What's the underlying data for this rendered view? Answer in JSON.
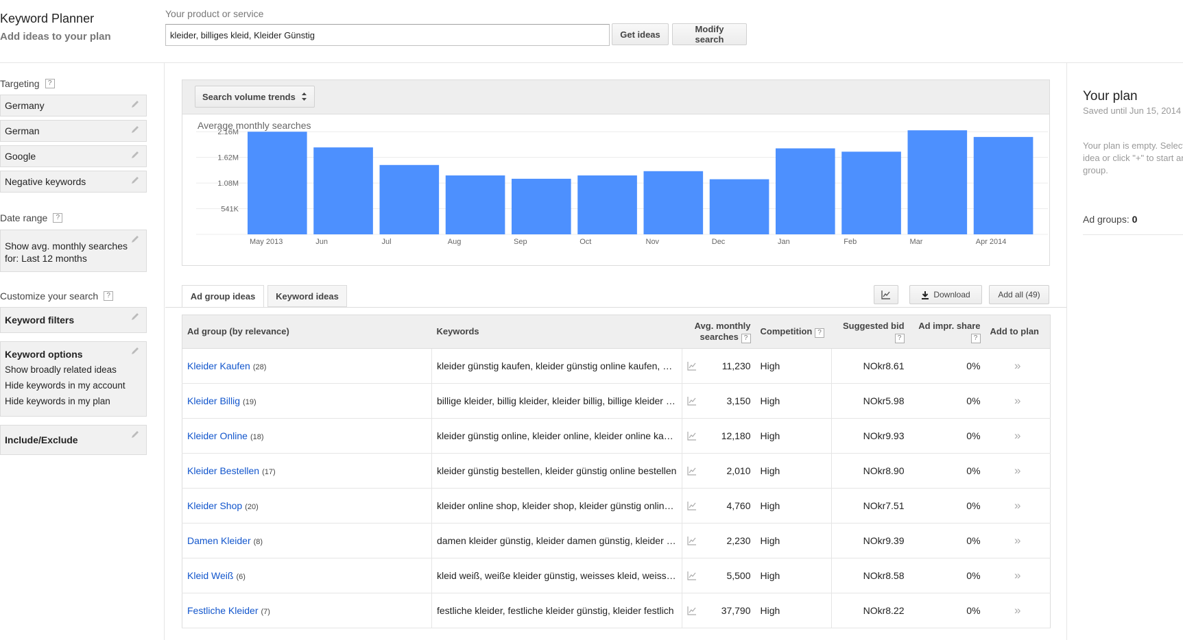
{
  "header": {
    "title": "Keyword Planner",
    "subtitle": "Add ideas to your plan",
    "product_label": "Your product or service",
    "search_value": "kleider, billiges kleid, Kleider Günstig",
    "get_ideas_label": "Get ideas",
    "modify_search_label": "Modify search"
  },
  "sidebar": {
    "targeting_label": "Targeting",
    "targeting_items": [
      {
        "label": "Germany"
      },
      {
        "label": "German"
      },
      {
        "label": "Google"
      },
      {
        "label": "Negative keywords"
      }
    ],
    "date_range_label": "Date range",
    "date_range_line1": "Show avg. monthly searches",
    "date_range_line2": "for: Last 12 months",
    "customize_label": "Customize your search",
    "keyword_filters_label": "Keyword filters",
    "keyword_options_label": "Keyword options",
    "keyword_options_items": [
      "Show broadly related ideas",
      "Hide keywords in my account",
      "Hide keywords in my plan"
    ],
    "include_exclude_label": "Include/Exclude",
    "help_glyph": "?"
  },
  "chart_toolbar": {
    "select_label": "Search volume trends"
  },
  "chart_data": {
    "type": "bar",
    "title": "Average monthly searches",
    "categories": [
      "May 2013",
      "Jun",
      "Jul",
      "Aug",
      "Sep",
      "Oct",
      "Nov",
      "Dec",
      "Jan",
      "Feb",
      "Mar",
      "Apr 2014"
    ],
    "values": [
      2160000,
      1830000,
      1460000,
      1240000,
      1170000,
      1240000,
      1330000,
      1160000,
      1810000,
      1740000,
      2190000,
      2050000
    ],
    "yticks": [
      541000,
      1080000,
      1620000,
      2160000
    ],
    "ytick_labels": [
      "541K",
      "1.08M",
      "1.62M",
      "2.16M"
    ],
    "ylim": [
      0,
      2160000
    ],
    "bar_color": "#4d90fe",
    "grid": true
  },
  "tabs": [
    {
      "label": "Ad group ideas",
      "active": true
    },
    {
      "label": "Keyword ideas",
      "active": false
    }
  ],
  "toolbar": {
    "download_label": "Download",
    "add_all_label": "Add all (49)"
  },
  "table": {
    "headers": {
      "ad_group": "Ad group (by relevance)",
      "keywords": "Keywords",
      "avg_line1": "Avg. monthly",
      "avg_line2": "searches",
      "competition": "Competition",
      "bid": "Suggested bid",
      "impr": "Ad impr. share",
      "add": "Add to plan"
    },
    "rows": [
      {
        "ad_group": "Kleider Kaufen",
        "count": "(28)",
        "keywords": "kleider günstig kaufen, kleider günstig online kaufen, kleider kaufen",
        "avg": "11,230",
        "competition": "High",
        "bid": "NOkr8.61",
        "impr": "0%"
      },
      {
        "ad_group": "Kleider Billig",
        "count": "(19)",
        "keywords": "billige kleider, billig kleider, kleider billig, billige kleider online",
        "avg": "3,150",
        "competition": "High",
        "bid": "NOkr5.98",
        "impr": "0%"
      },
      {
        "ad_group": "Kleider Online",
        "count": "(18)",
        "keywords": "kleider günstig online, kleider online, kleider online kaufen",
        "avg": "12,180",
        "competition": "High",
        "bid": "NOkr9.93",
        "impr": "0%"
      },
      {
        "ad_group": "Kleider Bestellen",
        "count": "(17)",
        "keywords": "kleider günstig bestellen, kleider günstig online bestellen",
        "avg": "2,010",
        "competition": "High",
        "bid": "NOkr8.90",
        "impr": "0%"
      },
      {
        "ad_group": "Kleider Shop",
        "count": "(20)",
        "keywords": "kleider online shop, kleider shop, kleider günstig online shop",
        "avg": "4,760",
        "competition": "High",
        "bid": "NOkr7.51",
        "impr": "0%"
      },
      {
        "ad_group": "Damen Kleider",
        "count": "(8)",
        "keywords": "damen kleider günstig, kleider damen günstig, kleider damen",
        "avg": "2,230",
        "competition": "High",
        "bid": "NOkr9.39",
        "impr": "0%"
      },
      {
        "ad_group": "Kleid Weiß",
        "count": "(6)",
        "keywords": "kleid weiß, weiße kleider günstig, weisses kleid, weisse kleider",
        "avg": "5,500",
        "competition": "High",
        "bid": "NOkr8.58",
        "impr": "0%"
      },
      {
        "ad_group": "Festliche Kleider",
        "count": "(7)",
        "keywords": "festliche kleider, festliche kleider günstig, kleider festlich",
        "avg": "37,790",
        "competition": "High",
        "bid": "NOkr8.22",
        "impr": "0%"
      }
    ]
  },
  "plan": {
    "title": "Your plan",
    "saved": "Saved until Jun 15, 2014",
    "empty_text": "Your plan is empty. Select an idea or click \"+\" to start an ad group.",
    "ad_groups_label": "Ad groups:",
    "ad_groups_count": "0"
  }
}
